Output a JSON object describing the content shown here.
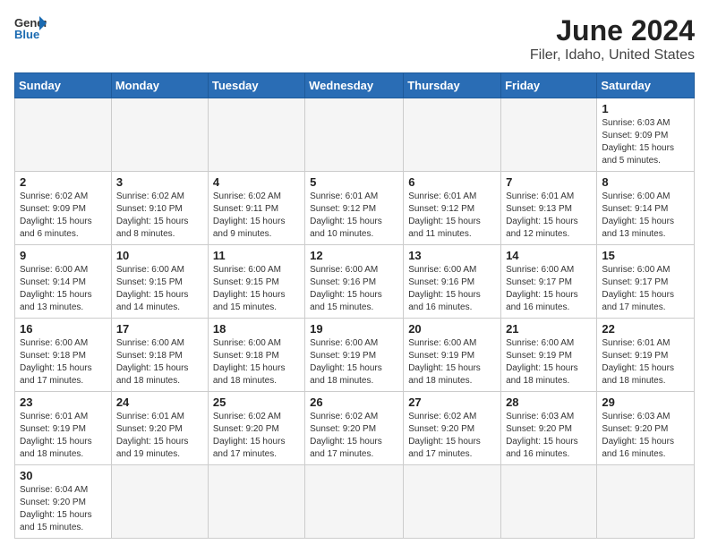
{
  "logo": {
    "general": "General",
    "blue": "Blue"
  },
  "title": "June 2024",
  "subtitle": "Filer, Idaho, United States",
  "days_of_week": [
    "Sunday",
    "Monday",
    "Tuesday",
    "Wednesday",
    "Thursday",
    "Friday",
    "Saturday"
  ],
  "weeks": [
    [
      {
        "day": "",
        "info": ""
      },
      {
        "day": "",
        "info": ""
      },
      {
        "day": "",
        "info": ""
      },
      {
        "day": "",
        "info": ""
      },
      {
        "day": "",
        "info": ""
      },
      {
        "day": "",
        "info": ""
      },
      {
        "day": "1",
        "info": "Sunrise: 6:03 AM\nSunset: 9:09 PM\nDaylight: 15 hours and 5 minutes."
      }
    ],
    [
      {
        "day": "2",
        "info": "Sunrise: 6:02 AM\nSunset: 9:09 PM\nDaylight: 15 hours and 6 minutes."
      },
      {
        "day": "3",
        "info": "Sunrise: 6:02 AM\nSunset: 9:10 PM\nDaylight: 15 hours and 8 minutes."
      },
      {
        "day": "4",
        "info": "Sunrise: 6:02 AM\nSunset: 9:11 PM\nDaylight: 15 hours and 9 minutes."
      },
      {
        "day": "5",
        "info": "Sunrise: 6:01 AM\nSunset: 9:12 PM\nDaylight: 15 hours and 10 minutes."
      },
      {
        "day": "6",
        "info": "Sunrise: 6:01 AM\nSunset: 9:12 PM\nDaylight: 15 hours and 11 minutes."
      },
      {
        "day": "7",
        "info": "Sunrise: 6:01 AM\nSunset: 9:13 PM\nDaylight: 15 hours and 12 minutes."
      },
      {
        "day": "8",
        "info": "Sunrise: 6:00 AM\nSunset: 9:14 PM\nDaylight: 15 hours and 13 minutes."
      }
    ],
    [
      {
        "day": "9",
        "info": "Sunrise: 6:00 AM\nSunset: 9:14 PM\nDaylight: 15 hours and 13 minutes."
      },
      {
        "day": "10",
        "info": "Sunrise: 6:00 AM\nSunset: 9:15 PM\nDaylight: 15 hours and 14 minutes."
      },
      {
        "day": "11",
        "info": "Sunrise: 6:00 AM\nSunset: 9:15 PM\nDaylight: 15 hours and 15 minutes."
      },
      {
        "day": "12",
        "info": "Sunrise: 6:00 AM\nSunset: 9:16 PM\nDaylight: 15 hours and 15 minutes."
      },
      {
        "day": "13",
        "info": "Sunrise: 6:00 AM\nSunset: 9:16 PM\nDaylight: 15 hours and 16 minutes."
      },
      {
        "day": "14",
        "info": "Sunrise: 6:00 AM\nSunset: 9:17 PM\nDaylight: 15 hours and 16 minutes."
      },
      {
        "day": "15",
        "info": "Sunrise: 6:00 AM\nSunset: 9:17 PM\nDaylight: 15 hours and 17 minutes."
      }
    ],
    [
      {
        "day": "16",
        "info": "Sunrise: 6:00 AM\nSunset: 9:18 PM\nDaylight: 15 hours and 17 minutes."
      },
      {
        "day": "17",
        "info": "Sunrise: 6:00 AM\nSunset: 9:18 PM\nDaylight: 15 hours and 18 minutes."
      },
      {
        "day": "18",
        "info": "Sunrise: 6:00 AM\nSunset: 9:18 PM\nDaylight: 15 hours and 18 minutes."
      },
      {
        "day": "19",
        "info": "Sunrise: 6:00 AM\nSunset: 9:19 PM\nDaylight: 15 hours and 18 minutes."
      },
      {
        "day": "20",
        "info": "Sunrise: 6:00 AM\nSunset: 9:19 PM\nDaylight: 15 hours and 18 minutes."
      },
      {
        "day": "21",
        "info": "Sunrise: 6:00 AM\nSunset: 9:19 PM\nDaylight: 15 hours and 18 minutes."
      },
      {
        "day": "22",
        "info": "Sunrise: 6:01 AM\nSunset: 9:19 PM\nDaylight: 15 hours and 18 minutes."
      }
    ],
    [
      {
        "day": "23",
        "info": "Sunrise: 6:01 AM\nSunset: 9:19 PM\nDaylight: 15 hours and 18 minutes."
      },
      {
        "day": "24",
        "info": "Sunrise: 6:01 AM\nSunset: 9:20 PM\nDaylight: 15 hours and 19 minutes."
      },
      {
        "day": "25",
        "info": "Sunrise: 6:02 AM\nSunset: 9:20 PM\nDaylight: 15 hours and 17 minutes."
      },
      {
        "day": "26",
        "info": "Sunrise: 6:02 AM\nSunset: 9:20 PM\nDaylight: 15 hours and 17 minutes."
      },
      {
        "day": "27",
        "info": "Sunrise: 6:02 AM\nSunset: 9:20 PM\nDaylight: 15 hours and 17 minutes."
      },
      {
        "day": "28",
        "info": "Sunrise: 6:03 AM\nSunset: 9:20 PM\nDaylight: 15 hours and 16 minutes."
      },
      {
        "day": "29",
        "info": "Sunrise: 6:03 AM\nSunset: 9:20 PM\nDaylight: 15 hours and 16 minutes."
      }
    ],
    [
      {
        "day": "30",
        "info": "Sunrise: 6:04 AM\nSunset: 9:20 PM\nDaylight: 15 hours and 15 minutes."
      },
      {
        "day": "",
        "info": ""
      },
      {
        "day": "",
        "info": ""
      },
      {
        "day": "",
        "info": ""
      },
      {
        "day": "",
        "info": ""
      },
      {
        "day": "",
        "info": ""
      },
      {
        "day": "",
        "info": ""
      }
    ]
  ]
}
